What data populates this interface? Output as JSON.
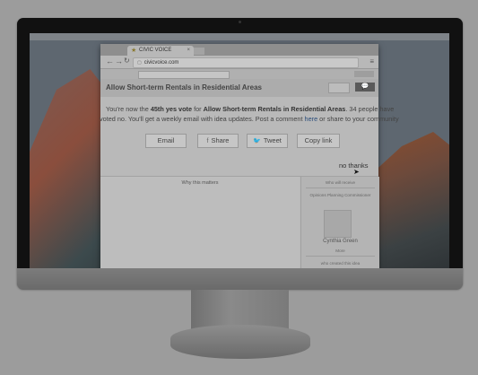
{
  "browser": {
    "tab_title": "CIVIC VOICE",
    "url": "civicvoice.com"
  },
  "page": {
    "title": "Allow Short-term Rentals in Residential Areas",
    "vote_line1_a": "You're now the ",
    "vote_ordinal": "45th yes vote",
    "vote_line1_b": " for ",
    "vote_topic": "Allow Short-term Rentals in Residential Areas",
    "vote_line1_c": ". 34 people have",
    "vote_line2_a": "voted no. You'll get a weekly email with idea updates. Post a comment ",
    "vote_here": "here",
    "vote_line2_b": " or share to your community",
    "share_buttons": [
      "Email",
      "Share",
      "Tweet",
      "Copy link"
    ],
    "no_thanks": "no thanks",
    "why_title": "Why this matters",
    "sidebar_head": "Who will receive",
    "sidebar_role": "Opinions Planning Commissioner",
    "sidebar_name": "Cynthia Green",
    "sidebar_more": "More",
    "sidebar_created": "who created this idea"
  }
}
